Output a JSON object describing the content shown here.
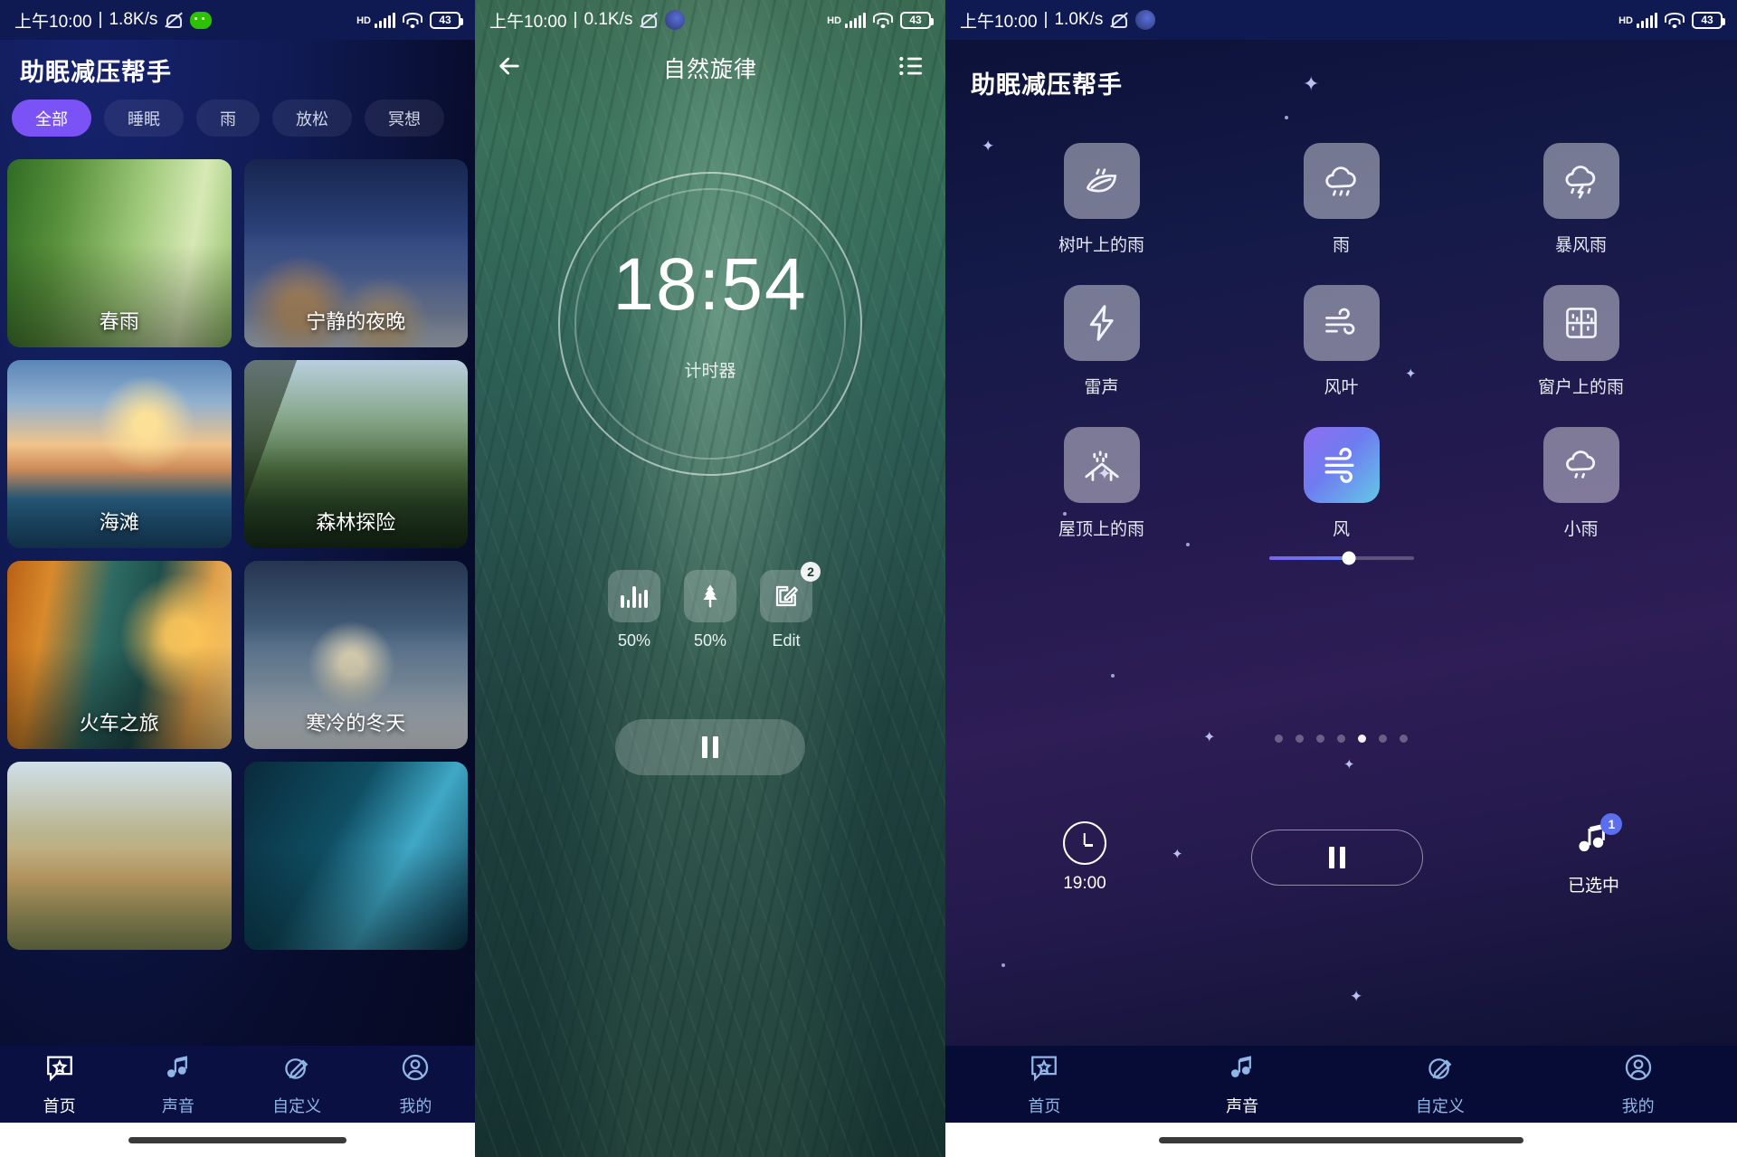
{
  "statusbars": [
    {
      "time": "上午10:00",
      "sep": "|",
      "net": "1.8K/s",
      "icons": [
        "mute-icon",
        "wechat-icon"
      ],
      "hd": "HD",
      "battery": "43"
    },
    {
      "time": "上午10:00",
      "sep": "|",
      "net": "0.1K/s",
      "icons": [
        "mute-icon",
        "moon-icon"
      ],
      "hd": "HD",
      "battery": "43"
    },
    {
      "time": "上午10:00",
      "sep": "|",
      "net": "1.0K/s",
      "icons": [
        "mute-icon",
        "moon-icon"
      ],
      "hd": "HD",
      "battery": "43"
    }
  ],
  "screen1": {
    "title": "助眠减压帮手",
    "chips": [
      {
        "label": "全部",
        "active": true
      },
      {
        "label": "睡眠",
        "active": false
      },
      {
        "label": "雨",
        "active": false
      },
      {
        "label": "放松",
        "active": false
      },
      {
        "label": "冥想",
        "active": false
      }
    ],
    "cards": [
      {
        "label": "春雨",
        "art": "a-bamboo"
      },
      {
        "label": "宁静的夜晚",
        "art": "a-night"
      },
      {
        "label": "海滩",
        "art": "a-beach"
      },
      {
        "label": "森林探险",
        "art": "a-forest"
      },
      {
        "label": "火车之旅",
        "art": "a-train"
      },
      {
        "label": "寒冷的冬天",
        "art": "a-winter"
      },
      {
        "label": "",
        "art": "a-field"
      },
      {
        "label": "",
        "art": "a-ice"
      }
    ],
    "nav": [
      {
        "label": "首页",
        "icon": "home-star-icon",
        "active": true
      },
      {
        "label": "声音",
        "icon": "music-note-icon",
        "active": false
      },
      {
        "label": "自定义",
        "icon": "customize-pencil-icon",
        "active": false
      },
      {
        "label": "我的",
        "icon": "profile-icon",
        "active": false
      }
    ]
  },
  "screen2": {
    "back_icon": "back-arrow-icon",
    "title": "自然旋律",
    "list_icon": "list-icon",
    "timer": "18:54",
    "timer_label": "计时器",
    "mixers": [
      {
        "icon": "equalizer-icon",
        "label": "50%",
        "badge": ""
      },
      {
        "icon": "tree-icon",
        "label": "50%",
        "badge": ""
      },
      {
        "icon": "edit-icon",
        "label": "Edit",
        "badge": "2"
      }
    ],
    "play_state": "pause-icon"
  },
  "screen3": {
    "title": "助眠减压帮手",
    "sounds": [
      {
        "label": "树叶上的雨",
        "icon": "leaf-rain-icon",
        "active": false
      },
      {
        "label": "雨",
        "icon": "cloud-rain-icon",
        "active": false
      },
      {
        "label": "暴风雨",
        "icon": "thunderstorm-icon",
        "active": false
      },
      {
        "label": "雷声",
        "icon": "lightning-icon",
        "active": false
      },
      {
        "label": "风叶",
        "icon": "wind-leaf-icon",
        "active": false
      },
      {
        "label": "窗户上的雨",
        "icon": "window-rain-icon",
        "active": false
      },
      {
        "label": "屋顶上的雨",
        "icon": "roof-rain-icon",
        "active": false
      },
      {
        "label": "风",
        "icon": "wind-icon",
        "active": true
      },
      {
        "label": "小雨",
        "icon": "light-rain-icon",
        "active": false
      }
    ],
    "slider_value": "55",
    "page_dots": {
      "count": 7,
      "active_index": 4
    },
    "timer_label": "19:00",
    "timer_icon": "clock-icon",
    "play_state": "pause-icon",
    "selected_label": "已选中",
    "selected_badge": "1",
    "selected_icon": "music-note-icon",
    "nav": [
      {
        "label": "首页",
        "icon": "home-star-icon",
        "active": false
      },
      {
        "label": "声音",
        "icon": "music-note-icon",
        "active": true
      },
      {
        "label": "自定义",
        "icon": "customize-pencil-icon",
        "active": false
      },
      {
        "label": "我的",
        "icon": "profile-icon",
        "active": false
      }
    ]
  },
  "colors": {
    "accent_purple": "#7b52f5",
    "nav_active": "#ffffff",
    "nav_inactive": "#8fb6e6",
    "screen1_bg": "#101a52",
    "screen3_bg": "#241a50",
    "badge_blue": "#5b6ef0"
  }
}
